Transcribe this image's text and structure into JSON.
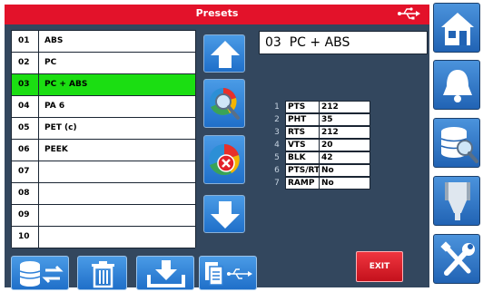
{
  "header": {
    "title": "Presets",
    "usb_icon": "usb-icon"
  },
  "presets": [
    {
      "num": "01",
      "name": "ABS"
    },
    {
      "num": "02",
      "name": "PC"
    },
    {
      "num": "03",
      "name": "PC + ABS"
    },
    {
      "num": "04",
      "name": "PA 6"
    },
    {
      "num": "05",
      "name": "PET (c)"
    },
    {
      "num": "06",
      "name": "PEEK"
    },
    {
      "num": "07",
      "name": ""
    },
    {
      "num": "08",
      "name": ""
    },
    {
      "num": "09",
      "name": ""
    },
    {
      "num": "10",
      "name": ""
    }
  ],
  "selected_index": 2,
  "selected_preset": "03  PC + ABS",
  "params": [
    {
      "num": "1",
      "key": "PTS",
      "value": "212"
    },
    {
      "num": "2",
      "key": "PHT",
      "value": "35"
    },
    {
      "num": "3",
      "key": "RTS",
      "value": "212"
    },
    {
      "num": "4",
      "key": "VTS",
      "value": "20"
    },
    {
      "num": "5",
      "key": "BLK",
      "value": "42"
    },
    {
      "num": "6",
      "key": "PTS/RTS",
      "value": "No"
    },
    {
      "num": "7",
      "key": "RAMP",
      "value": "No"
    }
  ],
  "exit_label": "EXIT",
  "colors": {
    "title_bar": "#e3122a",
    "selected_row": "#1bde12",
    "panel": "#33475e",
    "button": "#2f80d8",
    "exit": "#e0202c"
  },
  "icons": {
    "column": [
      "arrow-up-icon",
      "search-chart-icon",
      "delete-chart-icon",
      "arrow-down-icon"
    ],
    "bottom": [
      "database-sync-icon",
      "trash-icon",
      "download-icon",
      "copy-usb-icon"
    ],
    "sidebar": [
      "home-icon",
      "bell-icon",
      "database-search-icon",
      "nozzle-icon",
      "tools-icon"
    ]
  }
}
